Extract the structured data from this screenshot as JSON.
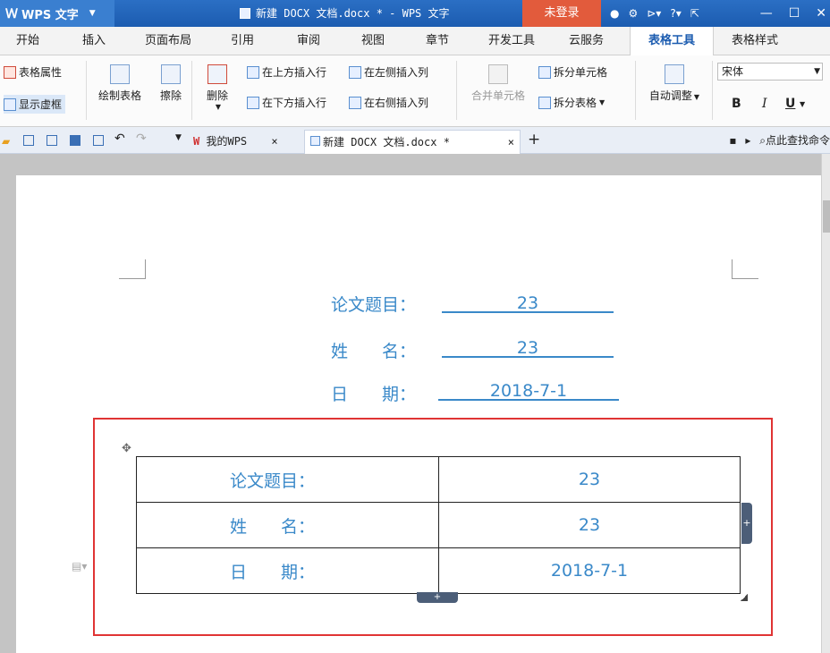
{
  "titlebar": {
    "app_name": "WPS 文字",
    "window_title": "新建 DOCX 文档.docx * - WPS 文字",
    "login": "未登录"
  },
  "tabs": [
    {
      "label": "开始"
    },
    {
      "label": "插入"
    },
    {
      "label": "页面布局"
    },
    {
      "label": "引用"
    },
    {
      "label": "审阅"
    },
    {
      "label": "视图"
    },
    {
      "label": "章节"
    },
    {
      "label": "开发工具"
    },
    {
      "label": "云服务"
    },
    {
      "label": "表格工具"
    },
    {
      "label": "表格样式"
    }
  ],
  "ribbon": {
    "table_props": "表格属性",
    "show_gridlines": "显示虚框",
    "draw_table": "绘制表格",
    "erase": "擦除",
    "delete": "删除",
    "insert_above": "在上方插入行",
    "insert_below": "在下方插入行",
    "insert_left": "在左侧插入列",
    "insert_right": "在右侧插入列",
    "merge_cells": "合并单元格",
    "split_cells": "拆分单元格",
    "split_table": "拆分表格",
    "auto_fit": "自动调整",
    "font_name": "宋体",
    "bold": "B",
    "italic": "I",
    "underline": "U"
  },
  "doc_tabs": {
    "my_wps": "我的WPS",
    "current_doc": "新建 DOCX 文档.docx *",
    "search": "点此查找命令"
  },
  "document": {
    "fields": [
      {
        "label": "论文题目：",
        "value": "23"
      },
      {
        "label": "姓　　名：",
        "value": "23"
      },
      {
        "label": "日　　期：",
        "value": "2018-7-1"
      }
    ],
    "table": [
      {
        "label": "论文题目：",
        "value": "23"
      },
      {
        "label": "姓　　名：",
        "value": "23"
      },
      {
        "label": "日　　期：",
        "value": "2018-7-1"
      }
    ]
  },
  "colors": {
    "title_blue": "#1c5cb0",
    "login_red": "#e25b3c",
    "text_blue": "#3a89c9",
    "highlight_red": "#e03434"
  }
}
